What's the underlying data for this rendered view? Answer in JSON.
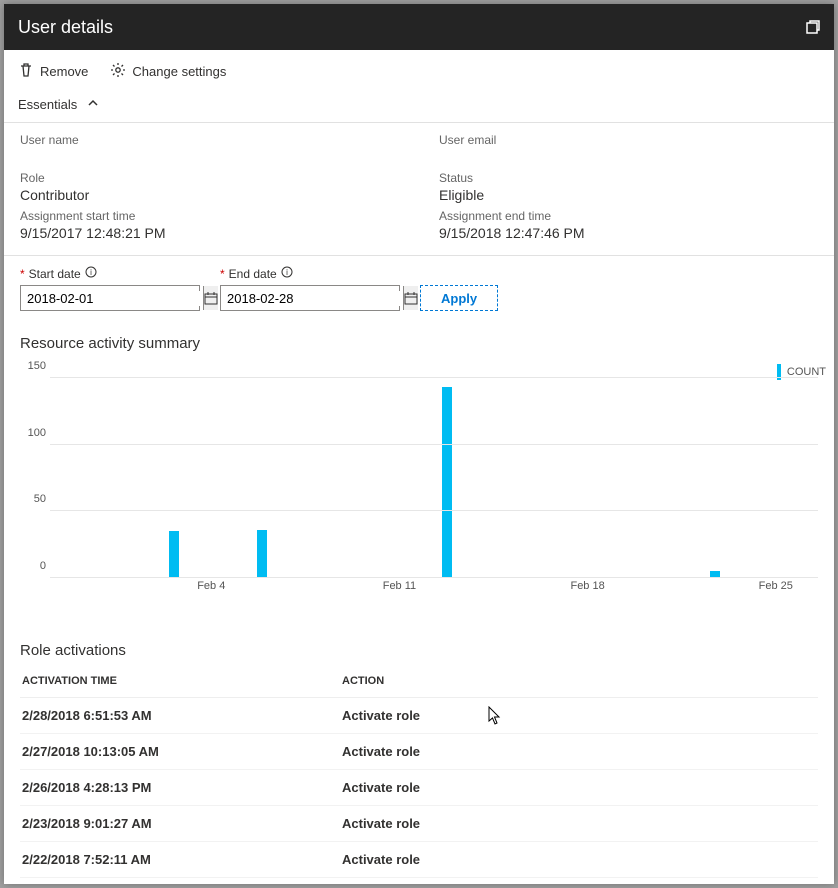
{
  "title": "User details",
  "toolbar": {
    "remove": "Remove",
    "change_settings": "Change settings"
  },
  "essentials": {
    "header": "Essentials",
    "user_name_label": "User name",
    "user_name_value": "",
    "user_email_label": "User email",
    "user_email_value": "",
    "role_label": "Role",
    "role_value": "Contributor",
    "status_label": "Status",
    "status_value": "Eligible",
    "start_label": "Assignment start time",
    "start_value": "9/15/2017 12:48:21 PM",
    "end_label": "Assignment end time",
    "end_value": "9/15/2018 12:47:46 PM"
  },
  "date_filter": {
    "start_label": "Start date",
    "start_value": "2018-02-01",
    "end_label": "End date",
    "end_value": "2018-02-28",
    "apply": "Apply"
  },
  "chart_title": "Resource activity summary",
  "chart_data": {
    "type": "bar",
    "title": "Resource activity summary",
    "xlabel": "",
    "ylabel": "",
    "ylim": [
      0,
      150
    ],
    "y_ticks": [
      0,
      50,
      100,
      150
    ],
    "x_tick_labels": [
      "Feb 4",
      "Feb 11",
      "Feb 18",
      "Feb 25"
    ],
    "legend": "COUNT",
    "series": [
      {
        "name": "COUNT",
        "color": "#00bcf2",
        "points": [
          {
            "x_position_pct": 15.5,
            "value": 35
          },
          {
            "x_position_pct": 27.0,
            "value": 36
          },
          {
            "x_position_pct": 51.0,
            "value": 143
          },
          {
            "x_position_pct": 86.0,
            "value": 5
          }
        ]
      }
    ]
  },
  "activations": {
    "title": "Role activations",
    "col_time": "Activation time",
    "col_action": "Action",
    "rows": [
      {
        "time": "2/28/2018 6:51:53 AM",
        "action": "Activate role"
      },
      {
        "time": "2/27/2018 10:13:05 AM",
        "action": "Activate role"
      },
      {
        "time": "2/26/2018 4:28:13 PM",
        "action": "Activate role"
      },
      {
        "time": "2/23/2018 9:01:27 AM",
        "action": "Activate role"
      },
      {
        "time": "2/22/2018 7:52:11 AM",
        "action": "Activate role"
      }
    ]
  }
}
